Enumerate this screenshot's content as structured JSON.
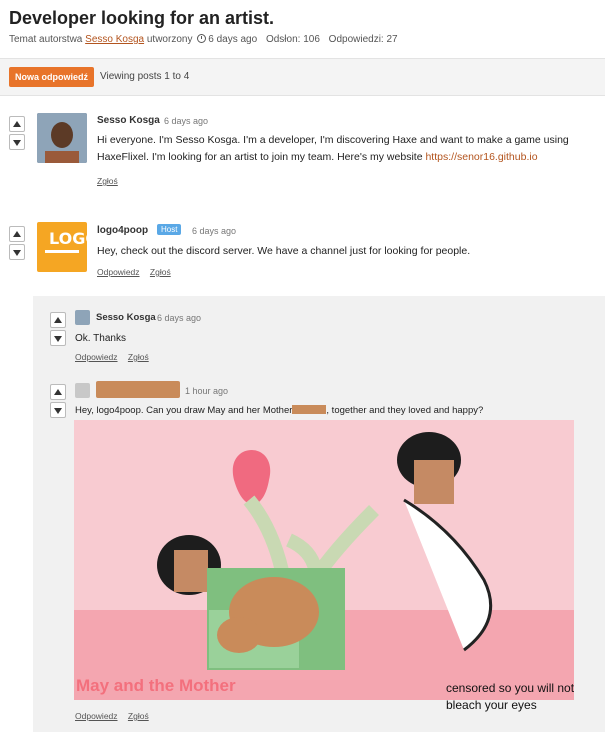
{
  "topic": {
    "title": "Developer looking for an artist.",
    "meta_prefix": "Temat autorstwa",
    "meta_author": "Sesso Kosga",
    "meta_created": "utworzony",
    "meta_age": "6 days ago",
    "views": "Odsłon: 106",
    "replies": "Odpowiedzi: 27"
  },
  "toolbar": {
    "new_reply_label": "Nowa odpowiedź",
    "viewing_text": "Viewing posts 1 to 4"
  },
  "posts": [
    {
      "author": "Sesso Kosga",
      "time": "6 days ago",
      "text": "Hi everyone. I'm Sesso Kosga. I'm a developer, I'm discovering Haxe and want to make a game using HaxeFlixel. I'm looking for an artist to join my team. Here's my website",
      "link": "https://senor16.github.io",
      "report": "Zgłoś"
    },
    {
      "author": "logo4poop",
      "badge": "Host",
      "time": "6 days ago",
      "text": "Hey, check out the discord server. We have a channel just for looking for people.",
      "reply": "Odpowiedz",
      "report": "Zgłoś"
    }
  ],
  "replies": [
    {
      "author": "Sesso Kosga",
      "time": "6 days ago",
      "text": "Ok. Thanks",
      "reply": "Odpowiedz",
      "report": "Zgłoś"
    },
    {
      "time": "1 hour ago",
      "text_before": "Hey, logo4poop. Can you draw May and her Mother",
      "text_after": ", together and they loved and happy?",
      "image_title": "May and the Mother",
      "image_caption": "censored so you will not bleach your eyes",
      "reply": "Odpowiedz",
      "report": "Zgłoś"
    }
  ],
  "logo_text": "LOGO",
  "colors": {
    "accent": "#e8742a",
    "link": "#b3541e",
    "host_badge": "#5aa8e6",
    "reply_bg": "#f1f1f1",
    "image_bg": "#f8cbd1"
  }
}
